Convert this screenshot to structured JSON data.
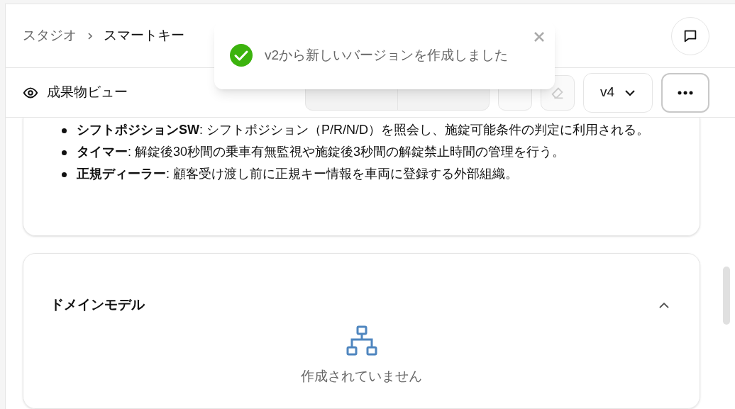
{
  "breadcrumb": [
    "スタジオ",
    "スマートキー"
  ],
  "view_title": "成果物ビュー",
  "version_select": "v4",
  "toast": {
    "message": "v2から新しいバージョンを作成しました"
  },
  "glossary": [
    {
      "term": "シフトポジションSW",
      "text": ": シフトポジション（P/R/N/D）を照会し、施錠可能条件の判定に利用される。"
    },
    {
      "term": "タイマー",
      "text": ": 解錠後30秒間の乗車有無監視や施錠後3秒間の解錠禁止時間の管理を行う。"
    },
    {
      "term": "正規ディーラー",
      "text": ": 顧客受け渡し前に正規キー情報を車両に登録する外部組織。"
    }
  ],
  "domain_model": {
    "title": "ドメインモデル",
    "expanded": true,
    "empty_message": "作成されていません"
  }
}
